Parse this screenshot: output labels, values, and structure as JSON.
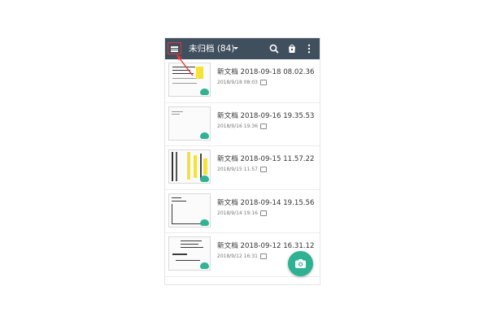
{
  "colors": {
    "appbar": "#3f4f5e",
    "accent": "#2fb291",
    "annotation": "#e03a3a"
  },
  "appbar": {
    "menu_icon": "hamburger-menu-icon",
    "title": "未归档 (84)",
    "actions": [
      "search-icon",
      "bag-icon",
      "more-vertical-icon"
    ]
  },
  "documents": [
    {
      "name": "新文档 2018-09-18 08.02.36",
      "date": "2018/9/18 08:03"
    },
    {
      "name": "新文档 2018-09-16 19.35.53",
      "date": "2018/9/16 19:36"
    },
    {
      "name": "新文档 2018-09-15 11.57.22",
      "date": "2018/9/15 11:57"
    },
    {
      "name": "新文档 2018-09-14 19.15.56",
      "date": "2018/9/14 19:16"
    },
    {
      "name": "新文档 2018-09-12 16.31.12",
      "date": "2018/9/12 16:31"
    }
  ],
  "fab_icon": "camera-icon"
}
